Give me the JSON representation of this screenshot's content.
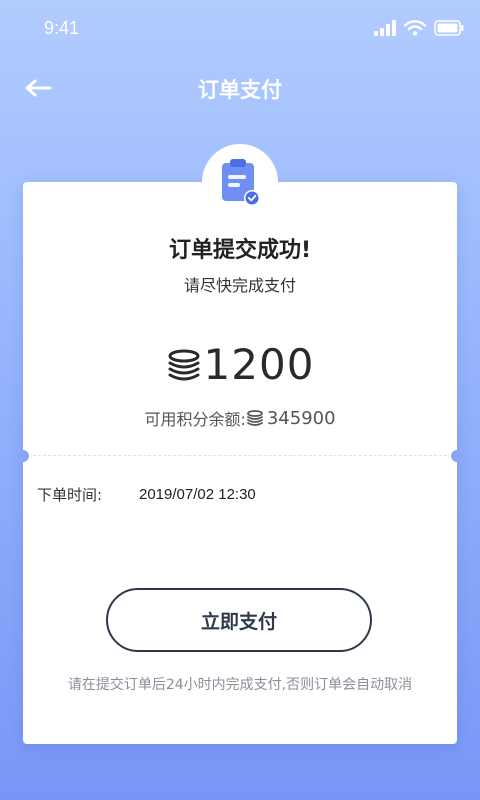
{
  "status_bar": {
    "time": "9:41"
  },
  "header": {
    "title": "订单支付"
  },
  "card": {
    "success_title": "订单提交成功!",
    "subtitle": "请尽快完成支付",
    "amount": "1200",
    "balance_label": "可用积分余额:",
    "balance_value": "345900",
    "order_time_label": "下单时间:",
    "order_time_value": "2019/07/02 12:30",
    "pay_button_label": "立即支付",
    "notice": "请在提交订单后24小时内完成支付,否则订单会自动取消"
  },
  "colors": {
    "accent": "#6f8ff5",
    "button_border": "#2e3a4c"
  },
  "icons": {
    "back": "back-arrow-icon",
    "order": "clipboard-check-icon",
    "coin": "coin-stack-icon"
  }
}
